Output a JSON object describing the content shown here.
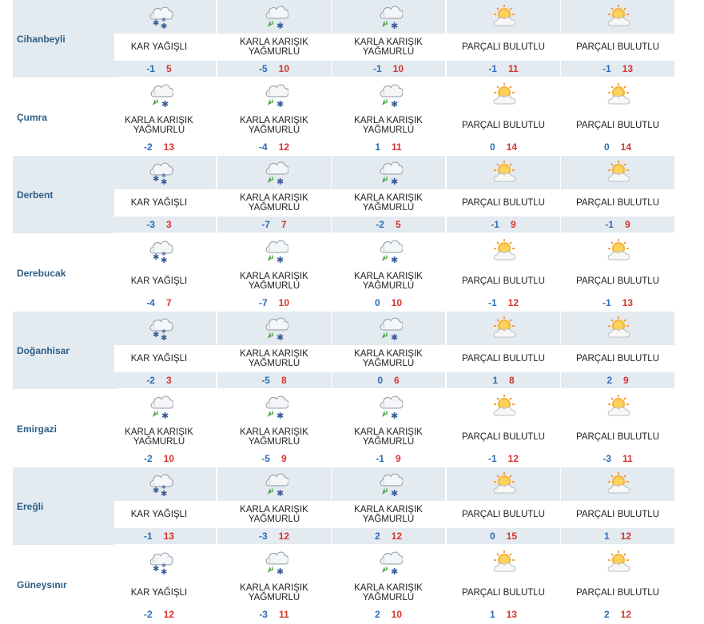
{
  "palette": {
    "band": "#e3eaf0",
    "city_text": "#2d5e86",
    "min_temp": "#2d6db5",
    "max_temp": "#d6342c",
    "text": "#222222"
  },
  "icons": {
    "snow": "cloud-snow-icon",
    "sleet": "cloud-sleet-icon",
    "partly": "partly-cloudy-icon"
  },
  "rows": [
    {
      "city": "Cihanbeyli",
      "days": [
        {
          "icon": "snow",
          "condition": "KAR YAĞIŞLI",
          "min": "-1",
          "max": "5"
        },
        {
          "icon": "sleet",
          "condition": "KARLA KARIŞIK\nYAĞMURLU",
          "min": "-5",
          "max": "10"
        },
        {
          "icon": "sleet",
          "condition": "KARLA KARIŞIK\nYAĞMURLU",
          "min": "-1",
          "max": "10"
        },
        {
          "icon": "partly",
          "condition": "PARÇALI BULUTLU",
          "min": "-1",
          "max": "11"
        },
        {
          "icon": "partly",
          "condition": "PARÇALI BULUTLU",
          "min": "-1",
          "max": "13"
        }
      ]
    },
    {
      "city": "Çumra",
      "days": [
        {
          "icon": "sleet",
          "condition": "KARLA KARIŞIK\nYAĞMURLU",
          "min": "-2",
          "max": "13"
        },
        {
          "icon": "sleet",
          "condition": "KARLA KARIŞIK\nYAĞMURLU",
          "min": "-4",
          "max": "12"
        },
        {
          "icon": "sleet",
          "condition": "KARLA KARIŞIK\nYAĞMURLU",
          "min": "1",
          "max": "11"
        },
        {
          "icon": "partly",
          "condition": "PARÇALI BULUTLU",
          "min": "0",
          "max": "14"
        },
        {
          "icon": "partly",
          "condition": "PARÇALI BULUTLU",
          "min": "0",
          "max": "14"
        }
      ]
    },
    {
      "city": "Derbent",
      "days": [
        {
          "icon": "snow",
          "condition": "KAR YAĞIŞLI",
          "min": "-3",
          "max": "3"
        },
        {
          "icon": "sleet",
          "condition": "KARLA KARIŞIK\nYAĞMURLU",
          "min": "-7",
          "max": "7"
        },
        {
          "icon": "sleet",
          "condition": "KARLA KARIŞIK\nYAĞMURLU",
          "min": "-2",
          "max": "5"
        },
        {
          "icon": "partly",
          "condition": "PARÇALI BULUTLU",
          "min": "-1",
          "max": "9"
        },
        {
          "icon": "partly",
          "condition": "PARÇALI BULUTLU",
          "min": "-1",
          "max": "9"
        }
      ]
    },
    {
      "city": "Derebucak",
      "days": [
        {
          "icon": "snow",
          "condition": "KAR YAĞIŞLI",
          "min": "-4",
          "max": "7"
        },
        {
          "icon": "sleet",
          "condition": "KARLA KARIŞIK\nYAĞMURLU",
          "min": "-7",
          "max": "10"
        },
        {
          "icon": "sleet",
          "condition": "KARLA KARIŞIK\nYAĞMURLU",
          "min": "0",
          "max": "10"
        },
        {
          "icon": "partly",
          "condition": "PARÇALI BULUTLU",
          "min": "-1",
          "max": "12"
        },
        {
          "icon": "partly",
          "condition": "PARÇALI BULUTLU",
          "min": "-1",
          "max": "13"
        }
      ]
    },
    {
      "city": "Doğanhisar",
      "days": [
        {
          "icon": "snow",
          "condition": "KAR YAĞIŞLI",
          "min": "-2",
          "max": "3"
        },
        {
          "icon": "sleet",
          "condition": "KARLA KARIŞIK\nYAĞMURLU",
          "min": "-5",
          "max": "8"
        },
        {
          "icon": "sleet",
          "condition": "KARLA KARIŞIK\nYAĞMURLU",
          "min": "0",
          "max": "6"
        },
        {
          "icon": "partly",
          "condition": "PARÇALI BULUTLU",
          "min": "1",
          "max": "8"
        },
        {
          "icon": "partly",
          "condition": "PARÇALI BULUTLU",
          "min": "2",
          "max": "9"
        }
      ]
    },
    {
      "city": "Emirgazi",
      "days": [
        {
          "icon": "sleet",
          "condition": "KARLA KARIŞIK\nYAĞMURLU",
          "min": "-2",
          "max": "10"
        },
        {
          "icon": "sleet",
          "condition": "KARLA KARIŞIK\nYAĞMURLU",
          "min": "-5",
          "max": "9"
        },
        {
          "icon": "sleet",
          "condition": "KARLA KARIŞIK\nYAĞMURLU",
          "min": "-1",
          "max": "9"
        },
        {
          "icon": "partly",
          "condition": "PARÇALI BULUTLU",
          "min": "-1",
          "max": "12"
        },
        {
          "icon": "partly",
          "condition": "PARÇALI BULUTLU",
          "min": "-3",
          "max": "11"
        }
      ]
    },
    {
      "city": "Ereğli",
      "days": [
        {
          "icon": "snow",
          "condition": "KAR YAĞIŞLI",
          "min": "-1",
          "max": "13"
        },
        {
          "icon": "sleet",
          "condition": "KARLA KARIŞIK\nYAĞMURLU",
          "min": "-3",
          "max": "12"
        },
        {
          "icon": "sleet",
          "condition": "KARLA KARIŞIK\nYAĞMURLU",
          "min": "2",
          "max": "12"
        },
        {
          "icon": "partly",
          "condition": "PARÇALI BULUTLU",
          "min": "0",
          "max": "15"
        },
        {
          "icon": "partly",
          "condition": "PARÇALI BULUTLU",
          "min": "1",
          "max": "12"
        }
      ]
    },
    {
      "city": "Güneysınır",
      "days": [
        {
          "icon": "snow",
          "condition": "KAR YAĞIŞLI",
          "min": "-2",
          "max": "12"
        },
        {
          "icon": "sleet",
          "condition": "KARLA KARIŞIK\nYAĞMURLU",
          "min": "-3",
          "max": "11"
        },
        {
          "icon": "sleet",
          "condition": "KARLA KARIŞIK\nYAĞMURLU",
          "min": "2",
          "max": "10"
        },
        {
          "icon": "partly",
          "condition": "PARÇALI BULUTLU",
          "min": "1",
          "max": "13"
        },
        {
          "icon": "partly",
          "condition": "PARÇALI BULUTLU",
          "min": "2",
          "max": "12"
        }
      ]
    }
  ]
}
